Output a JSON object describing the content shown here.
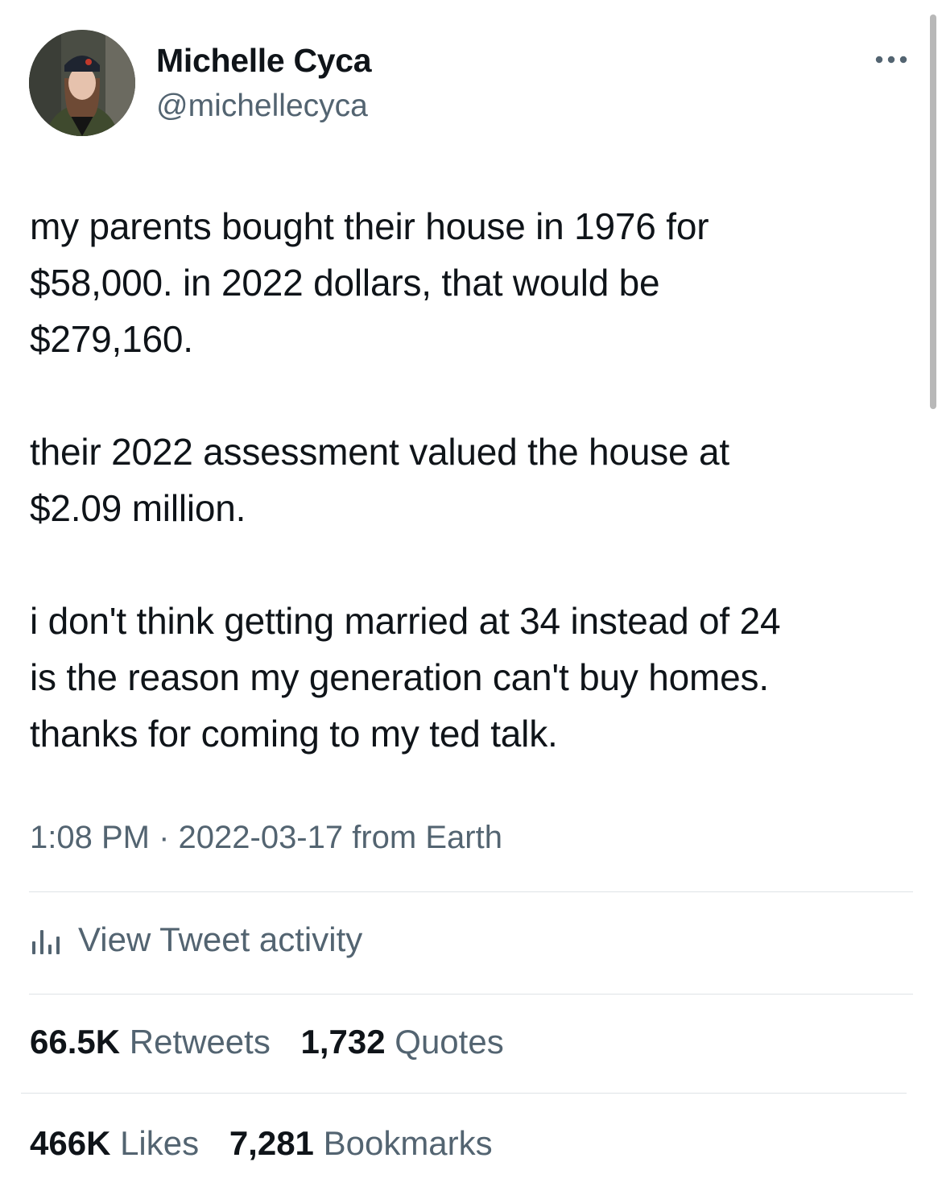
{
  "author": {
    "display_name": "Michelle Cyca",
    "handle": "@michellecyca"
  },
  "tweet": {
    "paragraphs": [
      "my parents bought their house in 1976 for\n$58,000. in 2022 dollars, that would be\n$279,160.",
      "their 2022 assessment valued the house at\n$2.09 million.",
      "i don't think getting married at 34 instead of 24\nis the reason my generation can't buy homes.\nthanks for coming to my ted talk."
    ],
    "timestamp": "1:08 PM · 2022-03-17 from Earth"
  },
  "activity": {
    "label": "View Tweet activity",
    "icon": "bar-chart-icon"
  },
  "stats": {
    "retweets": {
      "count": "66.5K",
      "label": "Retweets"
    },
    "quotes": {
      "count": "1,732",
      "label": "Quotes"
    },
    "likes": {
      "count": "466K",
      "label": "Likes"
    },
    "bookmarks": {
      "count": "7,281",
      "label": "Bookmarks"
    }
  },
  "icons": {
    "more": "more-horizontal-icon",
    "avatar": "avatar"
  },
  "colors": {
    "text_primary": "#0f1419",
    "text_secondary": "#536471",
    "divider": "#dfe3e6"
  }
}
